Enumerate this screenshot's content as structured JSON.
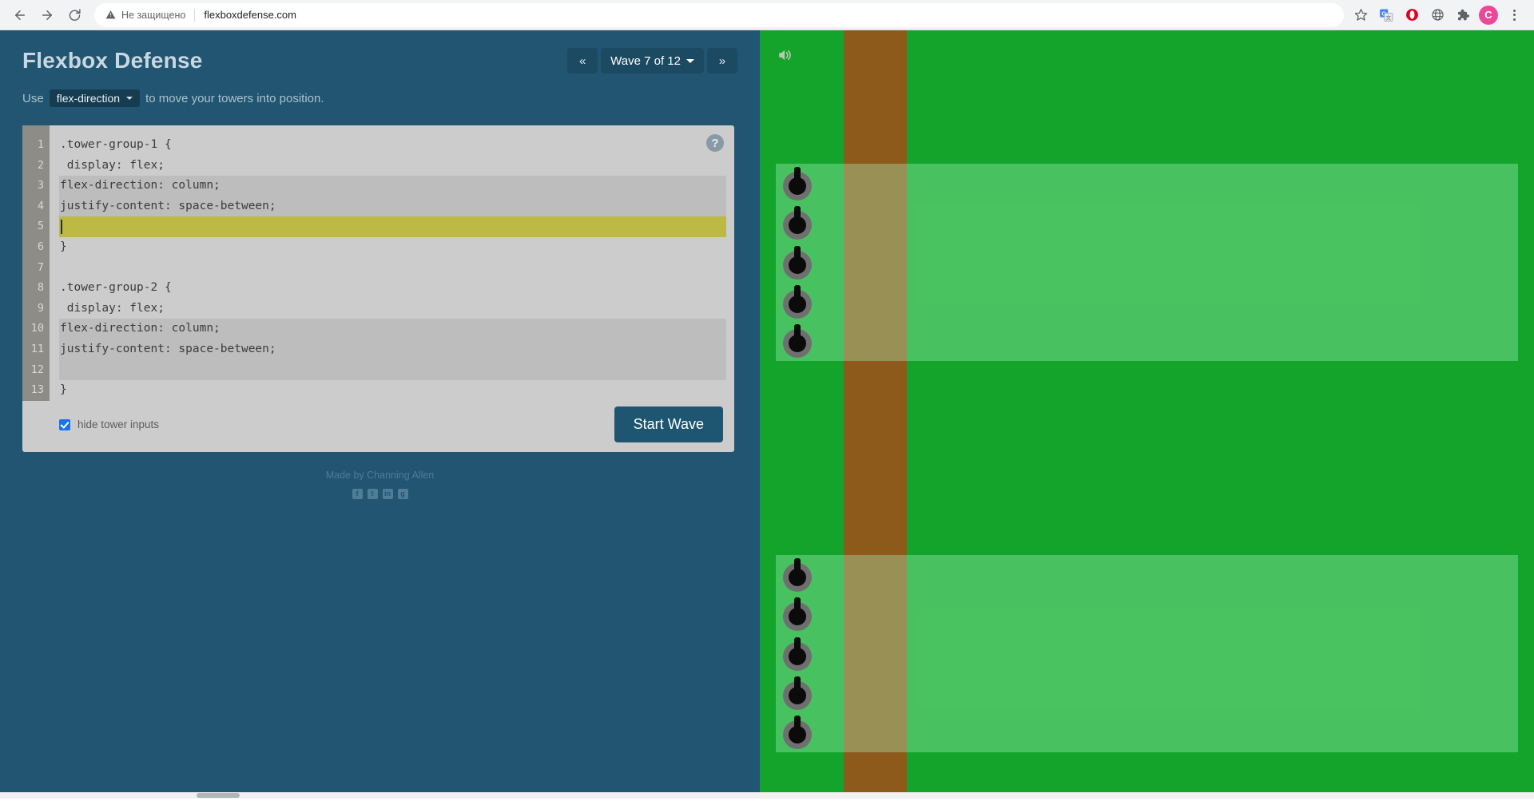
{
  "browser": {
    "back_label": "back-arrow",
    "forward_label": "forward-arrow",
    "reload_label": "reload",
    "security_text": "Не защищено",
    "url": "flexboxdefense.com",
    "actions": [
      {
        "name": "bookmark-star-icon",
        "label": "★"
      },
      {
        "name": "google-translate-icon",
        "label": "G"
      },
      {
        "name": "opera-shield-icon",
        "label": "O"
      },
      {
        "name": "globe-icon",
        "label": "◍"
      },
      {
        "name": "extensions-puzzle-icon",
        "label": "🧩"
      }
    ],
    "avatar_letter": "C",
    "menu_label": "⋮"
  },
  "game": {
    "title": "Flexbox Defense",
    "wave": {
      "prev_label": "«",
      "next_label": "»",
      "current_label": "Wave 7 of 12"
    },
    "instruction": {
      "prefix": "Use",
      "property": "flex-direction",
      "suffix": "to move your towers into position."
    },
    "help_label": "?",
    "editor": {
      "lines": [
        {
          "num": "1",
          "text": ".tower-group-1 {",
          "state": "static"
        },
        {
          "num": "2",
          "text": " display: flex;",
          "state": "static"
        },
        {
          "num": "3",
          "text": "flex-direction: column;",
          "state": "editable"
        },
        {
          "num": "4",
          "text": "justify-content: space-between;",
          "state": "editable"
        },
        {
          "num": "5",
          "text": "",
          "state": "active"
        },
        {
          "num": "6",
          "text": "}",
          "state": "static"
        },
        {
          "num": "7",
          "text": "",
          "state": "static"
        },
        {
          "num": "8",
          "text": ".tower-group-2 {",
          "state": "static"
        },
        {
          "num": "9",
          "text": " display: flex;",
          "state": "static"
        },
        {
          "num": "10",
          "text": "flex-direction: column;",
          "state": "editable"
        },
        {
          "num": "11",
          "text": "justify-content: space-between;",
          "state": "editable"
        },
        {
          "num": "12",
          "text": "",
          "state": "editable"
        },
        {
          "num": "13",
          "text": "}",
          "state": "static"
        }
      ]
    },
    "hide_tower_inputs_label": "hide tower inputs",
    "hide_tower_inputs_checked": true,
    "start_wave_label": "Start Wave",
    "credits": {
      "text": "Made by Channing Allen",
      "social": [
        {
          "name": "facebook-icon",
          "glyph": "f"
        },
        {
          "name": "twitter-icon",
          "glyph": "t"
        },
        {
          "name": "linkedin-icon",
          "glyph": "in"
        },
        {
          "name": "github-icon",
          "glyph": "g"
        }
      ]
    },
    "field": {
      "sound_icon_name": "sound-on-icon",
      "tower_group_1_count": 5,
      "tower_group_2_count": 5
    }
  },
  "colors": {
    "panel_bg": "#225571",
    "editor_bg": "#cccccc",
    "active_line": "#bcb945",
    "editable_line": "#bdbdbd",
    "grass": "#14a42b",
    "path": "#8d5a1c",
    "group_overlay": "#15bc50",
    "accent_button": "#1e5570"
  }
}
